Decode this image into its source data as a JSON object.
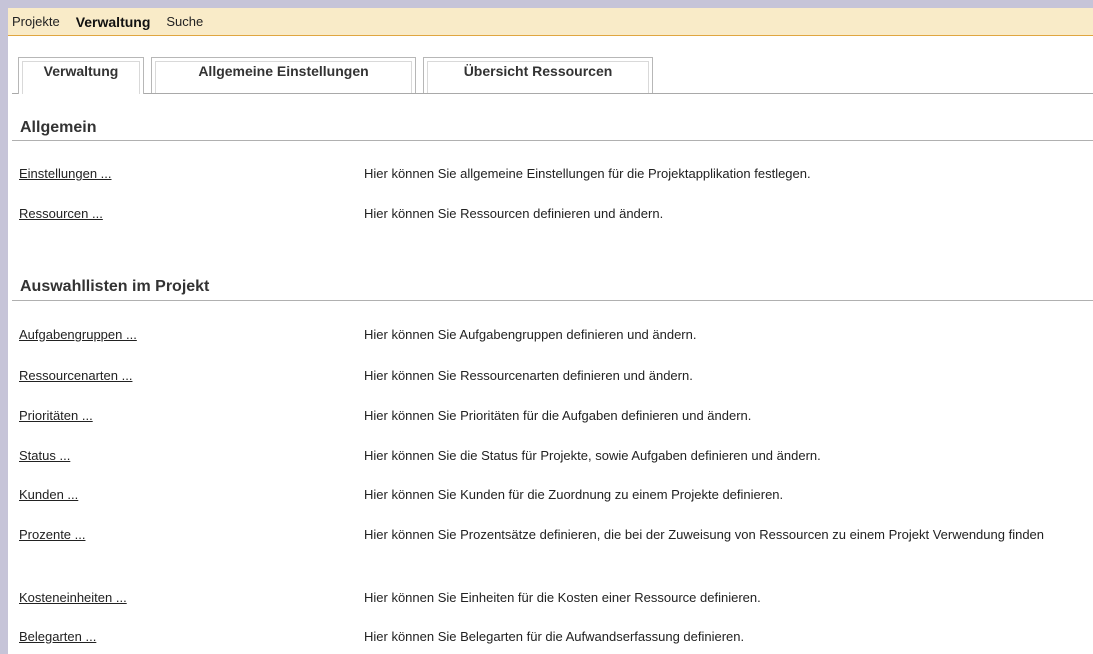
{
  "menu": {
    "items": [
      "Projekte",
      "Verwaltung",
      "Suche"
    ]
  },
  "tabs": [
    "Verwaltung",
    "Allgemeine Einstellungen",
    "Übersicht Ressourcen"
  ],
  "sections": [
    {
      "title": "Allgemein",
      "rows": [
        {
          "link": "Einstellungen ...",
          "desc": "Hier können Sie allgemeine Einstellungen für die Projektapplikation festlegen."
        },
        {
          "link": "Ressourcen ...",
          "desc": "Hier können Sie Ressourcen definieren und ändern."
        }
      ]
    },
    {
      "title": "Auswahllisten im Projekt",
      "rows": [
        {
          "link": "Aufgabengruppen ...",
          "desc": "Hier können Sie Aufgabengruppen definieren und ändern."
        },
        {
          "link": "Ressourcenarten ...",
          "desc": "Hier können Sie Ressourcenarten definieren und ändern."
        },
        {
          "link": "Prioritäten ...",
          "desc": "Hier können Sie Prioritäten für die Aufgaben definieren und ändern."
        },
        {
          "link": "Status ...",
          "desc": "Hier können Sie die Status für Projekte, sowie Aufgaben definieren und ändern."
        },
        {
          "link": "Kunden ...",
          "desc": "Hier können Sie Kunden für die Zuordnung zu einem Projekte definieren."
        },
        {
          "link": "Prozente ...",
          "desc": "Hier können Sie Prozentsätze definieren, die bei der Zuweisung von Ressourcen zu einem Projekt Verwendung finden"
        },
        {
          "link": "Kosteneinheiten ...",
          "desc": "Hier können Sie Einheiten für die Kosten einer Ressource definieren."
        },
        {
          "link": "Belegarten ...",
          "desc": "Hier können Sie Belegarten für die Aufwandserfassung definieren."
        }
      ]
    }
  ]
}
